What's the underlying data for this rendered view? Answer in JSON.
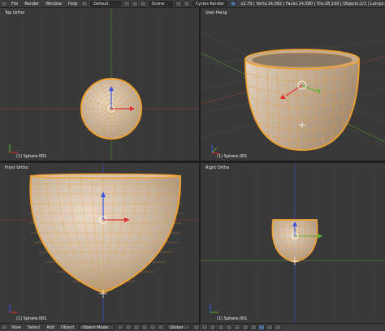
{
  "header": {
    "menu": [
      "File",
      "Render",
      "Window",
      "Help"
    ],
    "layout": "Default",
    "scene": "Scene",
    "engine": "Cycles Render",
    "stats": "v2.79 | Verts:14,082 | Faces:14,080 | Tris:28,160 | Objects:1/1 | Lamps:"
  },
  "viewports": {
    "top_left": {
      "label": "Top Ortho",
      "object": "(1) Sphere.001"
    },
    "top_right": {
      "label": "User Persp",
      "object": "(1) Sphere.001"
    },
    "bottom_left": {
      "label": "Front Ortho",
      "object": "(1) Sphere.001"
    },
    "bottom_right": {
      "label": "Right Ortho",
      "object": "(1) Sphere.001"
    }
  },
  "footer": {
    "menu": [
      "View",
      "Select",
      "Add",
      "Object"
    ],
    "mode": "Object Mode",
    "orientation": "Global"
  },
  "colors": {
    "viewport_bg": "#393939",
    "mesh_fill": "#c9b49e",
    "mesh_wire": "#f0a030",
    "header_bg": "#3c3c3c",
    "axis_red": "#c04040",
    "axis_green": "#5a9a3a"
  }
}
